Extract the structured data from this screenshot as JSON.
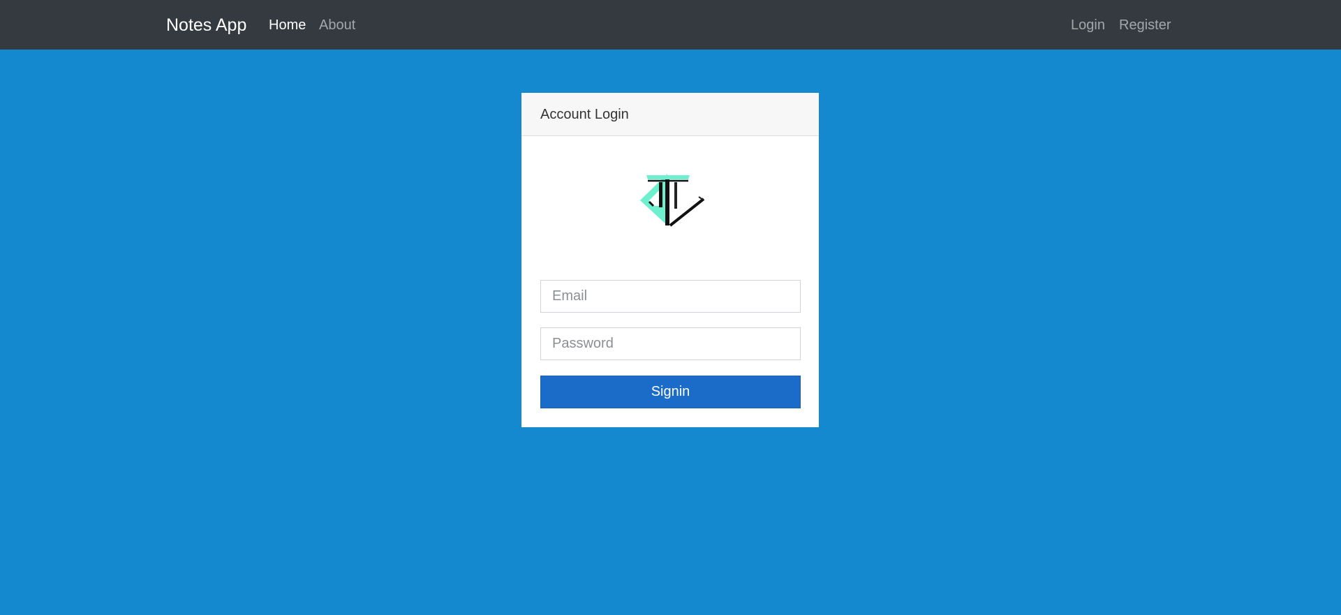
{
  "navbar": {
    "brand": "Notes App",
    "links_left": [
      {
        "label": "Home",
        "active": true
      },
      {
        "label": "About",
        "active": false
      }
    ],
    "links_right": [
      {
        "label": "Login"
      },
      {
        "label": "Register"
      }
    ]
  },
  "login_card": {
    "title": "Account Login",
    "logo_icon": "triangle-logo-icon",
    "email": {
      "placeholder": "Email",
      "value": ""
    },
    "password": {
      "placeholder": "Password",
      "value": ""
    },
    "submit_label": "Signin"
  },
  "colors": {
    "page_background": "#1589d0",
    "navbar_background": "#343a40",
    "button_background": "#1b6cc8",
    "logo_accent": "#6ef0cf"
  }
}
